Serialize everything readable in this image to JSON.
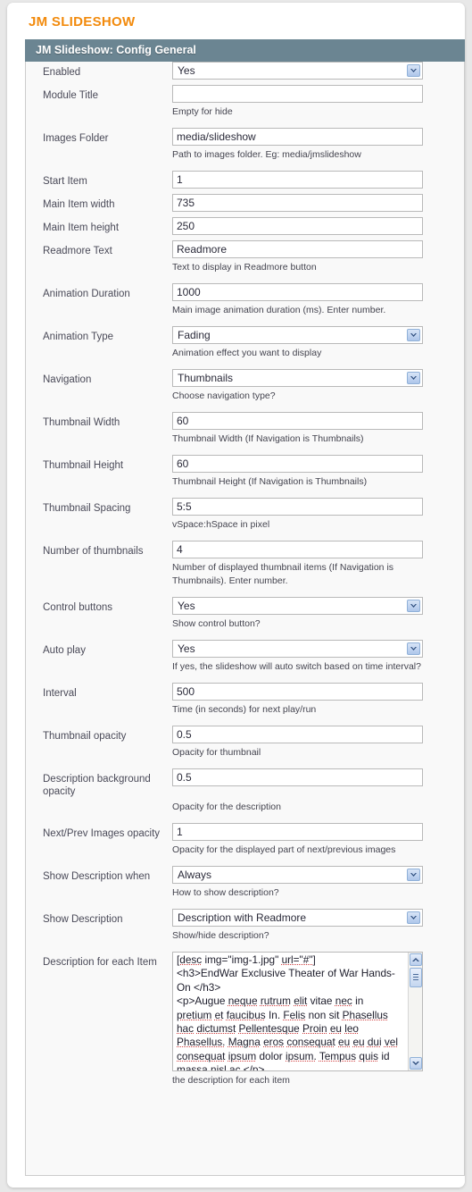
{
  "page": {
    "title": "JM SLIDESHOW",
    "legend": "JM Slideshow: Config General",
    "accent_color": "#f28a0c",
    "legend_bg": "#6b8592",
    "body_bg": "#f9f9f9"
  },
  "fields": [
    {
      "label": "Enabled",
      "type": "select",
      "value": "Yes",
      "hint": ""
    },
    {
      "label": "Module Title",
      "type": "text",
      "value": "",
      "hint": "Empty for hide"
    },
    {
      "label": "Images Folder",
      "type": "text",
      "value": "media/slideshow",
      "hint": "Path to images folder. Eg: media/jmslideshow"
    },
    {
      "label": "Start Item",
      "type": "text",
      "value": "1",
      "hint": ""
    },
    {
      "label": "Main Item width",
      "type": "text",
      "value": "735",
      "hint": ""
    },
    {
      "label": "Main Item height",
      "type": "text",
      "value": "250",
      "hint": ""
    },
    {
      "label": "Readmore Text",
      "type": "text",
      "value": "Readmore",
      "hint": "Text to display in Readmore button"
    },
    {
      "label": "Animation Duration",
      "type": "text",
      "value": "1000",
      "hint": "Main image animation duration (ms). Enter number."
    },
    {
      "label": "Animation Type",
      "type": "select",
      "value": "Fading",
      "hint": "Animation effect you want to display"
    },
    {
      "label": "Navigation",
      "type": "select",
      "value": "Thumbnails",
      "hint": "Choose navigation type?"
    },
    {
      "label": "Thumbnail Width",
      "type": "text",
      "value": "60",
      "hint": "Thumbnail Width (If Navigation is Thumbnails)"
    },
    {
      "label": "Thumbnail Height",
      "type": "text",
      "value": "60",
      "hint": "Thumbnail Height (If Navigation is Thumbnails)"
    },
    {
      "label": "Thumbnail Spacing",
      "type": "text",
      "value": "5:5",
      "hint": "vSpace:hSpace in pixel"
    },
    {
      "label": "Number of thumbnails",
      "type": "text",
      "value": "4",
      "hint": "Number of displayed thumbnail items (If Navigation is Thumbnails). Enter number."
    },
    {
      "label": "Control buttons",
      "type": "select",
      "value": "Yes",
      "hint": "Show control button?"
    },
    {
      "label": "Auto play",
      "type": "select",
      "value": "Yes",
      "hint": "If yes, the slideshow will auto switch based on time interval?"
    },
    {
      "label": "Interval",
      "type": "text",
      "value": "500",
      "hint": "Time (in seconds) for next play/run"
    },
    {
      "label": "Thumbnail opacity",
      "type": "text",
      "value": "0.5",
      "hint": "Opacity for thumbnail"
    },
    {
      "label": "Description background opacity",
      "type": "text",
      "value": "0.5",
      "hint": "Opacity for the description"
    },
    {
      "label": "Next/Prev Images opacity",
      "type": "text",
      "value": "1",
      "hint": "Opacity for the displayed part of next/previous images"
    },
    {
      "label": "Show Description when",
      "type": "select",
      "value": "Always",
      "hint": "How to show description?"
    },
    {
      "label": "Show Description",
      "type": "select",
      "value": "Description with Readmore",
      "hint": "Show/hide description?"
    },
    {
      "label": "Description for each Item",
      "type": "textarea",
      "value": "[desc img=\"img-1.jpg\" url=\"#\"]\n<h3>EndWar Exclusive Theater of War Hands-On </h3>\n<p>Augue neque rutrum elit vitae nec in pretium et faucibus In. Felis non sit Phasellus hac dictumst Pellentesque Proin eu leo Phasellus. Magna eros consequat eu eu dui vel consequat ipsum dolor ipsum. Tempus quis id massa nisl ac.</p>\n[/desc]",
      "hint": "the description for each item"
    }
  ],
  "icons": {
    "dropdown": "chevron-down-icon",
    "scroll_up": "scroll-up-arrow-icon",
    "scroll_down": "scroll-down-arrow-icon",
    "scroll_thumb": "scrollbar-thumb"
  }
}
